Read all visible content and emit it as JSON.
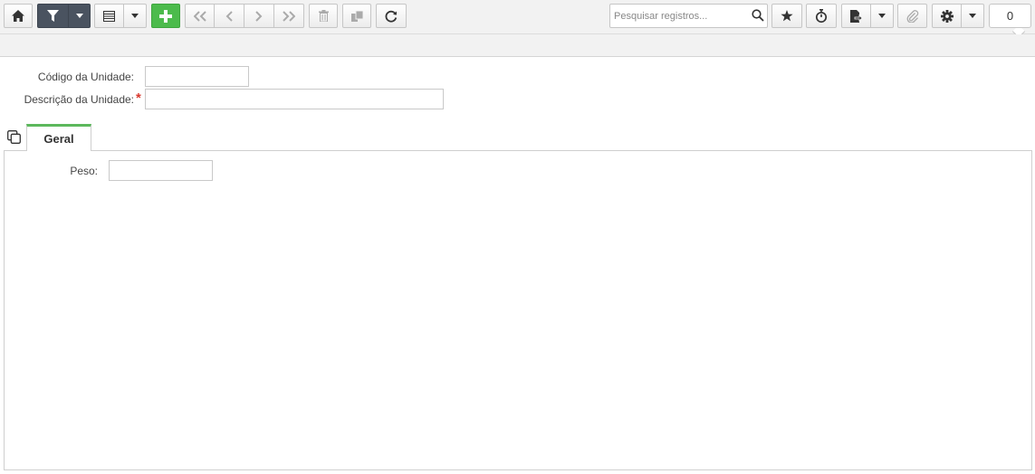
{
  "toolbar": {
    "buttons": [
      {
        "name": "home",
        "icon": "home-icon"
      },
      {
        "name": "filter",
        "icon": "filter-icon"
      },
      {
        "name": "filter-dropdown",
        "icon": "caret-down-icon"
      },
      {
        "name": "list-view",
        "icon": "list-icon"
      },
      {
        "name": "list-dropdown",
        "icon": "caret-down-icon"
      },
      {
        "name": "add",
        "icon": "plus-icon"
      },
      {
        "name": "first",
        "icon": "double-chevron-left-icon"
      },
      {
        "name": "previous",
        "icon": "chevron-left-icon"
      },
      {
        "name": "next",
        "icon": "chevron-right-icon"
      },
      {
        "name": "last",
        "icon": "double-chevron-right-icon"
      },
      {
        "name": "delete",
        "icon": "trash-icon"
      },
      {
        "name": "copy",
        "icon": "copy-icon"
      },
      {
        "name": "refresh",
        "icon": "refresh-icon"
      },
      {
        "name": "favorite",
        "icon": "star-icon"
      },
      {
        "name": "timer",
        "icon": "stopwatch-icon"
      },
      {
        "name": "export",
        "icon": "file-export-icon"
      },
      {
        "name": "export-dropdown",
        "icon": "caret-down-icon"
      },
      {
        "name": "attach",
        "icon": "paperclip-icon"
      },
      {
        "name": "settings",
        "icon": "gear-icon"
      },
      {
        "name": "settings-dropdown",
        "icon": "caret-down-icon"
      }
    ],
    "search": {
      "placeholder": "Pesquisar registros...",
      "value": ""
    },
    "counter": "0"
  },
  "colors": {
    "accent_green": "#4cbb4c",
    "dark_button": "#4a5360",
    "tab_accent": "#5cb85c",
    "required": "#d9382e"
  },
  "form": {
    "codigo": {
      "label": "Código da Unidade:",
      "value": ""
    },
    "descricao": {
      "label": "Descrição da Unidade:",
      "value": "",
      "required_mark": "*"
    }
  },
  "tabs": [
    {
      "label": "Geral",
      "active": true
    }
  ],
  "tab_geral": {
    "peso": {
      "label": "Peso:",
      "value": ""
    }
  }
}
